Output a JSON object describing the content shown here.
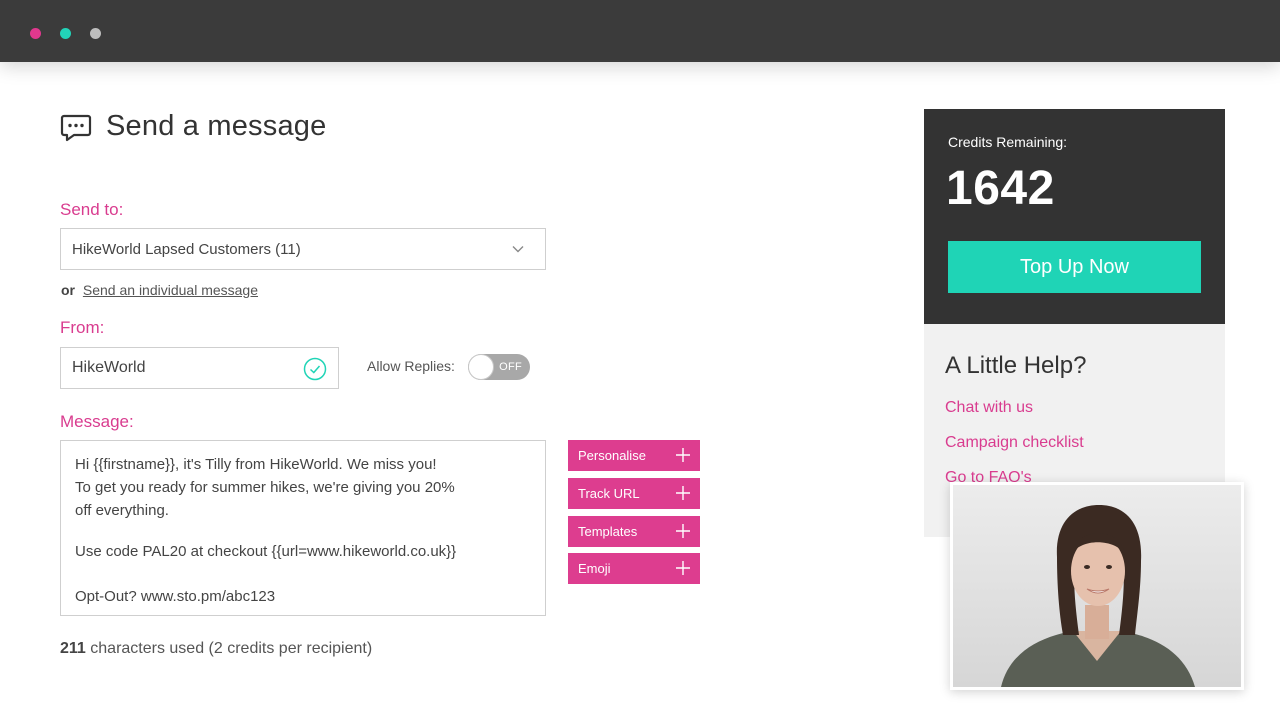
{
  "window": {
    "controls": [
      "close-dot",
      "minimize-dot",
      "zoom-dot"
    ]
  },
  "page": {
    "title": "Send a message"
  },
  "form": {
    "send_to_label": "Send to:",
    "send_to_value": "HikeWorld Lapsed Customers (11)",
    "or_text": "or",
    "individual_link": "Send an individual message",
    "from_label": "From:",
    "from_value": "HikeWorld",
    "allow_replies_label": "Allow Replies:",
    "allow_replies_state": "OFF",
    "message_label": "Message:",
    "message_lines": [
      "Hi {{firstname}}, it's Tilly from HikeWorld. We miss you!",
      "To get you ready for summer hikes, we're giving you 20%",
      "off everything.",
      "Use code PAL20 at checkout {{url=www.hikeworld.co.uk}}",
      "Opt-Out? www.sto.pm/abc123"
    ],
    "chars_count": "211",
    "chars_text": "characters used (2 credits per recipient)"
  },
  "tools": [
    {
      "label": "Personalise"
    },
    {
      "label": "Track URL"
    },
    {
      "label": "Templates"
    },
    {
      "label": "Emoji"
    }
  ],
  "credits": {
    "label": "Credits Remaining:",
    "value": "1642",
    "button": "Top Up Now"
  },
  "help": {
    "title": "A Little Help?",
    "links": [
      "Chat with us",
      "Campaign checklist",
      "Go to FAQ's"
    ]
  },
  "colors": {
    "accent": "#d93c8f",
    "teal": "#1fd4b6",
    "dark": "#333333"
  }
}
